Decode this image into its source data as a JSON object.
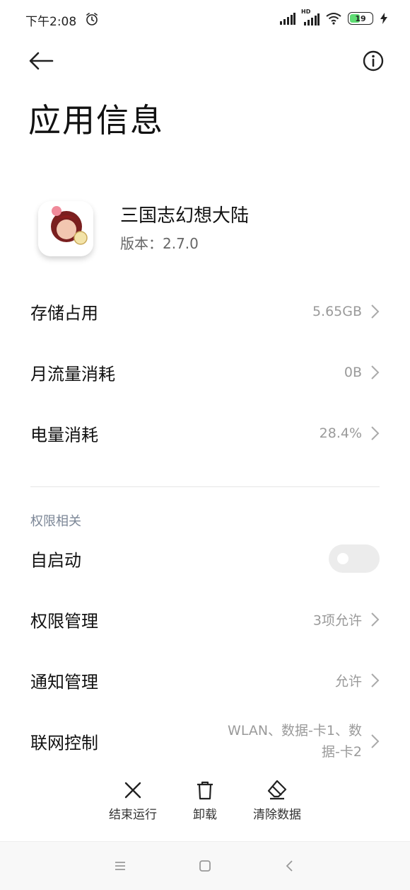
{
  "status_bar": {
    "time": "下午2:08",
    "network_tag": "HD",
    "battery_level": "19"
  },
  "header": {
    "title": "应用信息"
  },
  "app": {
    "name": "三国志幻想大陆",
    "version": "版本：2.7.0"
  },
  "rows": [
    {
      "label": "存储占用",
      "value": "5.65GB"
    },
    {
      "label": "月流量消耗",
      "value": "0B"
    },
    {
      "label": "电量消耗",
      "value": "28.4%"
    }
  ],
  "permissions_section": {
    "title": "权限相关",
    "autostart_label": "自启动",
    "autostart_on": false,
    "items": [
      {
        "label": "权限管理",
        "value": "3项允许"
      },
      {
        "label": "通知管理",
        "value": "允许"
      },
      {
        "label": "联网控制",
        "value_line1": "WLAN、数据-卡1、数",
        "value_line2": "据-卡2"
      }
    ]
  },
  "actions": [
    {
      "label": "结束运行",
      "icon": "close-icon"
    },
    {
      "label": "卸载",
      "icon": "trash-icon"
    },
    {
      "label": "清除数据",
      "icon": "eraser-icon"
    }
  ],
  "colors": {
    "battery": "#4cd964",
    "toggle_off": "#ececec",
    "secondary_text": "#9a9a9a",
    "section_label": "#7b8696"
  }
}
